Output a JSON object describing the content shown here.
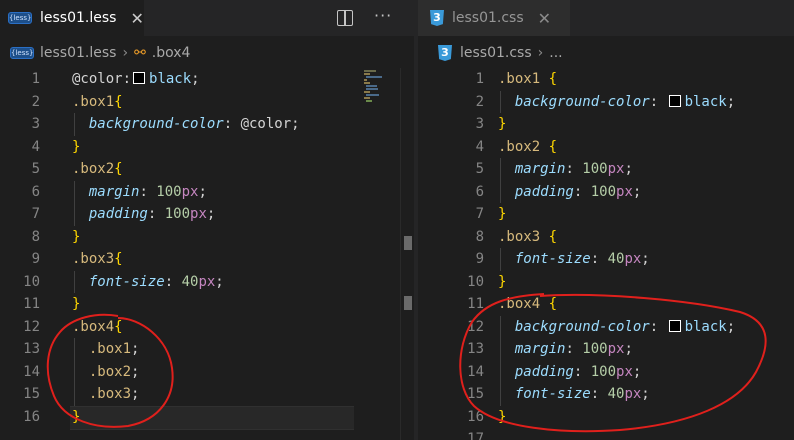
{
  "left": {
    "tab": {
      "label": "less01.less",
      "icon": "less",
      "close": "✕"
    },
    "toolbar": {
      "split": "split-editor-icon",
      "more": "···"
    },
    "breadcrumb": {
      "file": "less01.less",
      "separator": "›",
      "symbol": ".box4"
    },
    "lines": [
      {
        "n": "1",
        "tokens": [
          {
            "t": "@color",
            "c": "var"
          },
          {
            "t": ":",
            "c": "punc"
          },
          {
            "swatch": true
          },
          {
            "t": "black",
            "c": "val"
          },
          {
            "t": ";",
            "c": "punc"
          }
        ]
      },
      {
        "n": "2",
        "tokens": [
          {
            "t": ".box1",
            "c": "sel"
          },
          {
            "t": "{",
            "c": "brace"
          }
        ]
      },
      {
        "n": "3",
        "tokens": [
          {
            "t": "  "
          },
          {
            "t": "background-color",
            "c": "prop"
          },
          {
            "t": ": ",
            "c": "punc"
          },
          {
            "t": "@color",
            "c": "var"
          },
          {
            "t": ";",
            "c": "punc"
          }
        ]
      },
      {
        "n": "4",
        "tokens": [
          {
            "t": "}",
            "c": "brace"
          }
        ]
      },
      {
        "n": "5",
        "tokens": [
          {
            "t": ".box2",
            "c": "sel"
          },
          {
            "t": "{",
            "c": "brace"
          }
        ]
      },
      {
        "n": "6",
        "tokens": [
          {
            "t": "  "
          },
          {
            "t": "margin",
            "c": "prop"
          },
          {
            "t": ": ",
            "c": "punc"
          },
          {
            "t": "100",
            "c": "num"
          },
          {
            "t": "px",
            "c": "unit"
          },
          {
            "t": ";",
            "c": "punc"
          }
        ]
      },
      {
        "n": "7",
        "tokens": [
          {
            "t": "  "
          },
          {
            "t": "padding",
            "c": "prop"
          },
          {
            "t": ": ",
            "c": "punc"
          },
          {
            "t": "100",
            "c": "num"
          },
          {
            "t": "px",
            "c": "unit"
          },
          {
            "t": ";",
            "c": "punc"
          }
        ]
      },
      {
        "n": "8",
        "tokens": [
          {
            "t": "}",
            "c": "brace"
          }
        ]
      },
      {
        "n": "9",
        "tokens": [
          {
            "t": ".box3",
            "c": "sel"
          },
          {
            "t": "{",
            "c": "brace"
          }
        ]
      },
      {
        "n": "10",
        "tokens": [
          {
            "t": "  "
          },
          {
            "t": "font-size",
            "c": "prop"
          },
          {
            "t": ": ",
            "c": "punc"
          },
          {
            "t": "40",
            "c": "num"
          },
          {
            "t": "px",
            "c": "unit"
          },
          {
            "t": ";",
            "c": "punc"
          }
        ]
      },
      {
        "n": "11",
        "tokens": [
          {
            "t": "}",
            "c": "brace"
          }
        ]
      },
      {
        "n": "12",
        "tokens": [
          {
            "t": ".box4",
            "c": "sel"
          },
          {
            "t": "{",
            "c": "brace"
          }
        ]
      },
      {
        "n": "13",
        "tokens": [
          {
            "t": "  "
          },
          {
            "t": ".box1",
            "c": "sel"
          },
          {
            "t": ";",
            "c": "punc"
          }
        ]
      },
      {
        "n": "14",
        "tokens": [
          {
            "t": "  "
          },
          {
            "t": ".box2",
            "c": "sel"
          },
          {
            "t": ";",
            "c": "punc"
          }
        ]
      },
      {
        "n": "15",
        "tokens": [
          {
            "t": "  "
          },
          {
            "t": ".box3",
            "c": "sel"
          },
          {
            "t": ";",
            "c": "punc"
          }
        ]
      },
      {
        "n": "16",
        "tokens": [
          {
            "t": "}",
            "c": "brace"
          }
        ]
      }
    ]
  },
  "right": {
    "tab": {
      "label": "less01.css",
      "icon": "css",
      "close": "✕"
    },
    "breadcrumb": {
      "file": "less01.css",
      "separator": "›",
      "symbol": "..."
    },
    "lines": [
      {
        "n": "1",
        "tokens": [
          {
            "t": ".box1",
            "c": "sel"
          },
          {
            "t": " "
          },
          {
            "t": "{",
            "c": "brace"
          }
        ]
      },
      {
        "n": "2",
        "tokens": [
          {
            "t": "  "
          },
          {
            "t": "background-color",
            "c": "prop"
          },
          {
            "t": ": ",
            "c": "punc"
          },
          {
            "swatch": true
          },
          {
            "t": "black",
            "c": "val"
          },
          {
            "t": ";",
            "c": "punc"
          }
        ]
      },
      {
        "n": "3",
        "tokens": [
          {
            "t": "}",
            "c": "brace"
          }
        ]
      },
      {
        "n": "4",
        "tokens": [
          {
            "t": ".box2",
            "c": "sel"
          },
          {
            "t": " "
          },
          {
            "t": "{",
            "c": "brace"
          }
        ]
      },
      {
        "n": "5",
        "tokens": [
          {
            "t": "  "
          },
          {
            "t": "margin",
            "c": "prop"
          },
          {
            "t": ": ",
            "c": "punc"
          },
          {
            "t": "100",
            "c": "num"
          },
          {
            "t": "px",
            "c": "unit"
          },
          {
            "t": ";",
            "c": "punc"
          }
        ]
      },
      {
        "n": "6",
        "tokens": [
          {
            "t": "  "
          },
          {
            "t": "padding",
            "c": "prop"
          },
          {
            "t": ": ",
            "c": "punc"
          },
          {
            "t": "100",
            "c": "num"
          },
          {
            "t": "px",
            "c": "unit"
          },
          {
            "t": ";",
            "c": "punc"
          }
        ]
      },
      {
        "n": "7",
        "tokens": [
          {
            "t": "}",
            "c": "brace"
          }
        ]
      },
      {
        "n": "8",
        "tokens": [
          {
            "t": ".box3",
            "c": "sel"
          },
          {
            "t": " "
          },
          {
            "t": "{",
            "c": "brace"
          }
        ]
      },
      {
        "n": "9",
        "tokens": [
          {
            "t": "  "
          },
          {
            "t": "font-size",
            "c": "prop"
          },
          {
            "t": ": ",
            "c": "punc"
          },
          {
            "t": "40",
            "c": "num"
          },
          {
            "t": "px",
            "c": "unit"
          },
          {
            "t": ";",
            "c": "punc"
          }
        ]
      },
      {
        "n": "10",
        "tokens": [
          {
            "t": "}",
            "c": "brace"
          }
        ]
      },
      {
        "n": "11",
        "tokens": [
          {
            "t": ".box4",
            "c": "sel"
          },
          {
            "t": " "
          },
          {
            "t": "{",
            "c": "brace"
          }
        ]
      },
      {
        "n": "12",
        "tokens": [
          {
            "t": "  "
          },
          {
            "t": "background-color",
            "c": "prop"
          },
          {
            "t": ": ",
            "c": "punc"
          },
          {
            "swatch": true
          },
          {
            "t": "black",
            "c": "val"
          },
          {
            "t": ";",
            "c": "punc"
          }
        ]
      },
      {
        "n": "13",
        "tokens": [
          {
            "t": "  "
          },
          {
            "t": "margin",
            "c": "prop"
          },
          {
            "t": ": ",
            "c": "punc"
          },
          {
            "t": "100",
            "c": "num"
          },
          {
            "t": "px",
            "c": "unit"
          },
          {
            "t": ";",
            "c": "punc"
          }
        ]
      },
      {
        "n": "14",
        "tokens": [
          {
            "t": "  "
          },
          {
            "t": "padding",
            "c": "prop"
          },
          {
            "t": ": ",
            "c": "punc"
          },
          {
            "t": "100",
            "c": "num"
          },
          {
            "t": "px",
            "c": "unit"
          },
          {
            "t": ";",
            "c": "punc"
          }
        ]
      },
      {
        "n": "15",
        "tokens": [
          {
            "t": "  "
          },
          {
            "t": "font-size",
            "c": "prop"
          },
          {
            "t": ": ",
            "c": "punc"
          },
          {
            "t": "40",
            "c": "num"
          },
          {
            "t": "px",
            "c": "unit"
          },
          {
            "t": ";",
            "c": "punc"
          }
        ]
      },
      {
        "n": "16",
        "tokens": [
          {
            "t": "}",
            "c": "brace"
          }
        ]
      },
      {
        "n": "17",
        "tokens": []
      }
    ]
  },
  "annotation_color": "#e0201c"
}
